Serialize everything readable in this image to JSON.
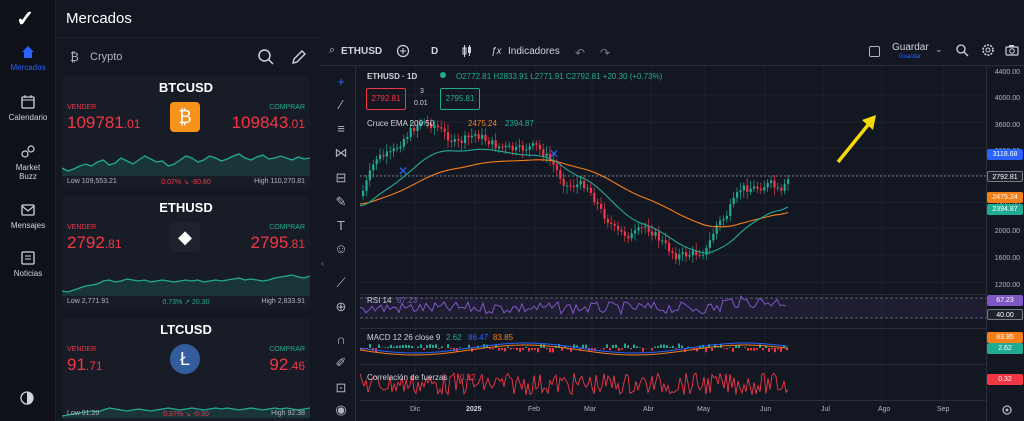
{
  "app": {
    "title": "Mercados"
  },
  "nav": {
    "items": [
      {
        "label": "Mercados",
        "icon": "home-icon"
      },
      {
        "label": "Calendario",
        "icon": "calendar-icon"
      },
      {
        "label": "Market Buzz",
        "icon": "buzz-icon"
      },
      {
        "label": "Mensajes",
        "icon": "mail-icon"
      },
      {
        "label": "Noticias",
        "icon": "news-icon"
      }
    ]
  },
  "market": {
    "category": "Crypto",
    "cards": [
      {
        "symbol": "BTCUSD",
        "sell_label": "VENDER",
        "buy_label": "COMPRAR",
        "sell_main": "109781",
        "sell_dec": ".01",
        "buy_main": "109843",
        "buy_dec": ".01",
        "low": "Low 109,553.21",
        "high": "High 110,270.81",
        "change": "0.07% ↘ -80.80",
        "change_color": "#f23645",
        "coin_color": "#f7931a",
        "coin_glyph": "₿",
        "line": [
          52,
          55,
          53,
          50,
          48,
          50,
          46,
          44,
          49,
          47,
          42,
          45,
          48,
          44,
          40,
          43,
          46,
          45,
          50,
          48,
          44,
          40,
          42,
          46,
          44,
          40,
          42,
          45,
          43,
          40,
          38,
          42,
          44,
          41,
          39,
          43,
          42,
          40,
          42,
          44,
          41,
          43,
          42
        ]
      },
      {
        "symbol": "ETHUSD",
        "sell_label": "VENDER",
        "buy_label": "COMPRAR",
        "sell_main": "2792",
        "sell_dec": ".81",
        "buy_main": "2795",
        "buy_dec": ".81",
        "low": "Low 2,771.91",
        "high": "High 2,833.91",
        "change": "0.73% ↗ 20.30",
        "change_color": "#22ab94",
        "coin_color": "#1e222d",
        "coin_glyph": "◆",
        "line": [
          55,
          56,
          54,
          52,
          50,
          49,
          48,
          45,
          44,
          46,
          45,
          43,
          44,
          45,
          44,
          46,
          45,
          44,
          45,
          46,
          45,
          44,
          45,
          44,
          46,
          45,
          44,
          45,
          44,
          43,
          42,
          44,
          43,
          44,
          45,
          44,
          42,
          41,
          40,
          39,
          41,
          42,
          40
        ]
      },
      {
        "symbol": "LTCUSD",
        "sell_label": "VENDER",
        "buy_label": "COMPRAR",
        "sell_main": "91",
        "sell_dec": ".71",
        "buy_main": "92",
        "buy_dec": ".46",
        "low": "Low 91.20",
        "high": "High 92.38",
        "change": "0.37% ↘ -0.30",
        "change_color": "#f23645",
        "coin_color": "#345d9d",
        "coin_glyph": "Ł",
        "line": [
          58,
          57,
          56,
          55,
          54,
          53,
          54,
          52,
          50,
          51,
          52,
          53,
          52,
          51,
          52,
          53,
          52,
          51,
          50,
          51,
          52,
          51,
          50,
          51,
          52,
          51,
          50,
          51,
          50,
          51,
          52,
          51,
          50,
          51,
          52,
          51,
          50,
          51,
          50,
          51,
          52,
          51,
          50
        ]
      }
    ]
  },
  "toolbar": {
    "symbol": "ETHUSD",
    "interval": "D",
    "indicators": "Indicadores",
    "save": "Guardar",
    "save_sub": "Guardar"
  },
  "chart": {
    "title": "ETHUSD · 1D",
    "ohlc": "O2772.81 H2833.91 L2771.91 C2792.81 +20.30 (+0.73%)",
    "sell_box": "2792.81",
    "spread_top": "3",
    "spread_bottom": "0.01",
    "buy_box": "2795.81",
    "ema_label": "Cruce EMA 200 50",
    "ema_v1": "2475.24",
    "ema_v2": "2394.87",
    "rsi_label": "RSI 14",
    "rsi_value": "67.23",
    "macd_label": "MACD 12 26 close 9",
    "macd_v1": "2.62",
    "macd_v2": "86.47",
    "macd_v3": "83.85",
    "corr_label": "Correlación de fuerzas",
    "corr_value": "0.32",
    "y_ticks": [
      "4400.00",
      "4000.00",
      "3600.00",
      "3200.00",
      "2800.00",
      "2400.00",
      "2000.00",
      "1600.00",
      "1200.00"
    ],
    "x_ticks": [
      "Dic",
      "2025",
      "Feb",
      "Mar",
      "Abr",
      "May",
      "Jun",
      "Jul",
      "Ago",
      "Sep"
    ],
    "price_tags": [
      {
        "value": "3118.68",
        "color": "#2962ff"
      },
      {
        "value": "2792.81",
        "color": "#1e222d"
      },
      {
        "value": "2475.24",
        "color": "#f57f17"
      },
      {
        "value": "2394.87",
        "color": "#22ab94"
      },
      {
        "value": "67.23",
        "color": "#7e57c2"
      },
      {
        "value": "40.00",
        "color": "#1e222d"
      },
      {
        "value": "83.85",
        "color": "#f57f17"
      },
      {
        "value": "2.62",
        "color": "#22ab94"
      },
      {
        "value": "0.32",
        "color": "#f23645"
      }
    ]
  }
}
